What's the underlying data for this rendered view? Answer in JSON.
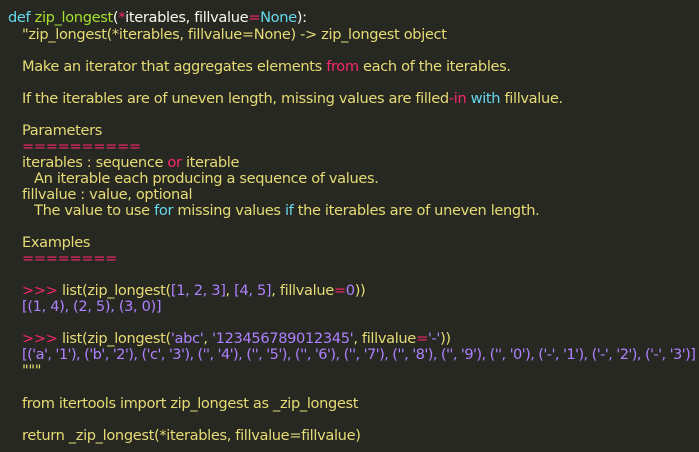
{
  "code": {
    "def_line": {
      "keyword": "def",
      "name": "zip_longest",
      "open": "(",
      "star": "*",
      "arg1": "iterables, ",
      "arg2": "fillvalue",
      "eq": "=",
      "default": "None",
      "close": "):"
    },
    "doc_signature": "\"zip_longest(*iterables, fillvalue=None) -> zip_longest object",
    "doc_summary": {
      "before": "Make an iterator that aggregates elements ",
      "keyword": "from",
      "after": " each of the iterables."
    },
    "doc_uneven": {
      "before": "If the iterables are of uneven length, missing values are filled",
      "dash": "-",
      "in_kw": "in",
      "space": " ",
      "with_kw": "with",
      "after": " fillvalue."
    },
    "params_heading": "Parameters",
    "params_underline": "==========",
    "param1": {
      "before": "iterables : sequence ",
      "or_kw": "or",
      "after": " iterable"
    },
    "param1_desc": "An iterable each producing a sequence of values.",
    "param2": "fillvalue : value, optional",
    "param2_desc": {
      "before": "The value to use ",
      "for_kw": "for",
      "middle": " missing values ",
      "if_kw": "if",
      "after": " the iterables are of uneven length."
    },
    "examples_heading": "Examples",
    "examples_underline": "========",
    "example1_call": {
      "prompt": ">>>",
      "sp": " ",
      "text1": "list(zip_longest(",
      "l1": "[1, 2, 3]",
      "comma": ", ",
      "l2": "[4, 5]",
      "text2": ", fillvalue",
      "eq": "=",
      "zero": "0",
      "close": "))"
    },
    "example1_result": "[(1, 4), (2, 5), (3, 0)]",
    "example2_call": {
      "prompt": ">>>",
      "sp": " ",
      "text1": "list(zip_longest(",
      "s1": "'abc'",
      "comma": ", ",
      "s2": "'123456789012345'",
      "text2": ", fillvalue",
      "eq": "=",
      "s3": "'-'",
      "close": "))"
    },
    "example2_result": "[('a', '1'), ('b', '2'), ('c', '3'), ('', '4'), ('', '5'), ('', '6'), ('', '7'), ('', '8'), ('', '9'), ('', '0'), ('-', '1'), ('-', '2'), ('-', '3')]",
    "doc_close": "\"\"\"",
    "import_line": "from itertools import zip_longest as _zip_longest",
    "return_line": "return _zip_longest(*iterables, fillvalue=fillvalue)"
  },
  "colors": {
    "background": "#272822",
    "keyword": "#66d9ef",
    "function_name": "#a6e22e",
    "operator": "#f92672",
    "number": "#ae81ff",
    "string": "#e6db74",
    "plain": "#f8f8f2"
  }
}
